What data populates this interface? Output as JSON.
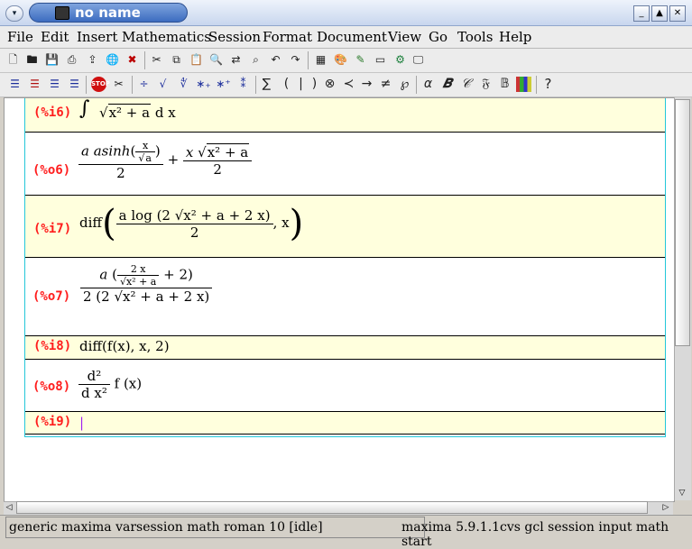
{
  "window": {
    "title": "no name"
  },
  "menus": [
    "File",
    "Edit",
    "Insert",
    "Mathematics",
    "Session",
    "Format",
    "Document",
    "View",
    "Go",
    "Tools",
    "Help"
  ],
  "toolbar1": [
    "new-document",
    "open-document",
    "save-document",
    "print-document",
    "export-document",
    "globe-icon",
    "close-document",
    "cut",
    "copy",
    "paste",
    "find",
    "replace",
    "search-next",
    "undo",
    "redo",
    "insert-table",
    "insert-image",
    "insert-drawing",
    "view-fullscreen",
    "session-tools",
    "settings"
  ],
  "toolbar2": [
    "align-left",
    "align-center",
    "align-right",
    "align-justify",
    "stop",
    "cut-session",
    "divide",
    "sqrt",
    "sqrt-n",
    "subscript",
    "superscript",
    "superscript-subscript",
    "sum",
    "paren-left",
    "bar",
    "paren-right",
    "otimes",
    "prec",
    "arrow-right",
    "not-equal",
    "wp",
    "alpha",
    "bold",
    "calligraphic",
    "fraktur",
    "blackboard",
    "color-grid",
    "help"
  ],
  "toolbar2_glyphs": [
    "∑",
    "(",
    "|",
    ")",
    "⊗",
    "≺",
    "→",
    "≠",
    "℘",
    "α",
    "𝑩",
    "𝒞",
    "𝔉",
    "𝔹",
    "?"
  ],
  "session": {
    "i6": {
      "label": "(%i6)",
      "integrand": "x² + a",
      "dx": "d x"
    },
    "o6": {
      "label": "(%o6)",
      "term1_num_a": "a asinh",
      "term1_inner_num": "x",
      "term1_inner_den": "a",
      "den": "2",
      "plus": "+",
      "term2_num_x": "x",
      "term2_sqrt": "x² + a"
    },
    "i7": {
      "label": "(%i7)",
      "func": "diff",
      "num": "a log (2 √x² + a + 2 x)",
      "den": "2",
      "var": ", x"
    },
    "o7": {
      "label": "(%o7)",
      "num_a": "a",
      "inner_num": "2 x",
      "inner_den": "√x² + a",
      "inner_plus": "+ 2",
      "den": "2 (2 √x² + a + 2 x)"
    },
    "i8": {
      "label": "(%i8)",
      "text": "diff(f(x), x, 2)"
    },
    "o8": {
      "label": "(%o8)",
      "num": "d²",
      "den": "d x²",
      "rest": "f (x)"
    },
    "i9": {
      "label": "(%i9)"
    }
  },
  "status": {
    "left": "generic maxima varsession math roman 10 [idle]",
    "right": "maxima 5.9.1.1cvs gcl session input math start"
  }
}
